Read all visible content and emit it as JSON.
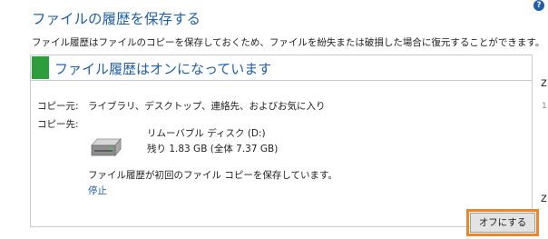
{
  "page": {
    "title": "ファイルの履歴を保存する",
    "description": "ファイル履歴はファイルのコピーを保存しておくため、ファイルを紛失または破損した場合に復元することができます。",
    "help_icon_glyph": "?"
  },
  "status": {
    "title": "ファイル履歴はオンになっています",
    "indicator_color": "#2e9e3c",
    "copy_from_label": "コピー元:",
    "copy_from_value": "ライブラリ、デスクトップ、連絡先、およびお気に入り",
    "copy_to_label": "コピー先:",
    "drive_icon": "removable-drive-icon",
    "drive_name": "リムーバブル ディスク (D:)",
    "drive_space": "残り 1.83 GB (全体 7.37 GB)",
    "saving_message": "ファイル履歴が初回のファイル コピーを保存しています。",
    "stop_link": "停止"
  },
  "actions": {
    "turn_off_button": "オフにする",
    "highlight_color": "#f0862c"
  },
  "edge_fragments": [
    "z",
    "1",
    "z"
  ]
}
